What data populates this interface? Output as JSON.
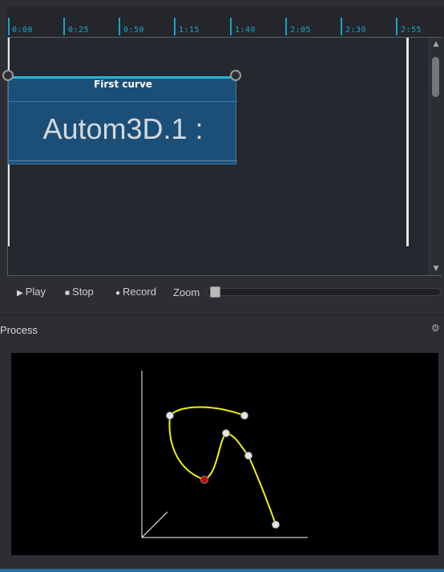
{
  "timeline": {
    "ticks": [
      "0:00",
      "0:25",
      "0:50",
      "1:15",
      "1:40",
      "2:05",
      "2:30",
      "2:55"
    ]
  },
  "process_box": {
    "title": "First curve",
    "content": "Autom3D.1 :"
  },
  "transport": {
    "play_label": "Play",
    "stop_label": "Stop",
    "record_label": "Record",
    "zoom_label": "Zoom",
    "zoom_level": 0.0
  },
  "panel": {
    "title": "Process"
  },
  "colors": {
    "accent": "#1aa3c7",
    "box_fill": "#1c4f78",
    "curve": "#f2f20a",
    "point": "#e6e6e6",
    "selected_point": "#cc0000"
  },
  "icons": {
    "play": "play-icon",
    "stop": "stop-icon",
    "record": "record-icon",
    "gear": "gear-icon"
  }
}
